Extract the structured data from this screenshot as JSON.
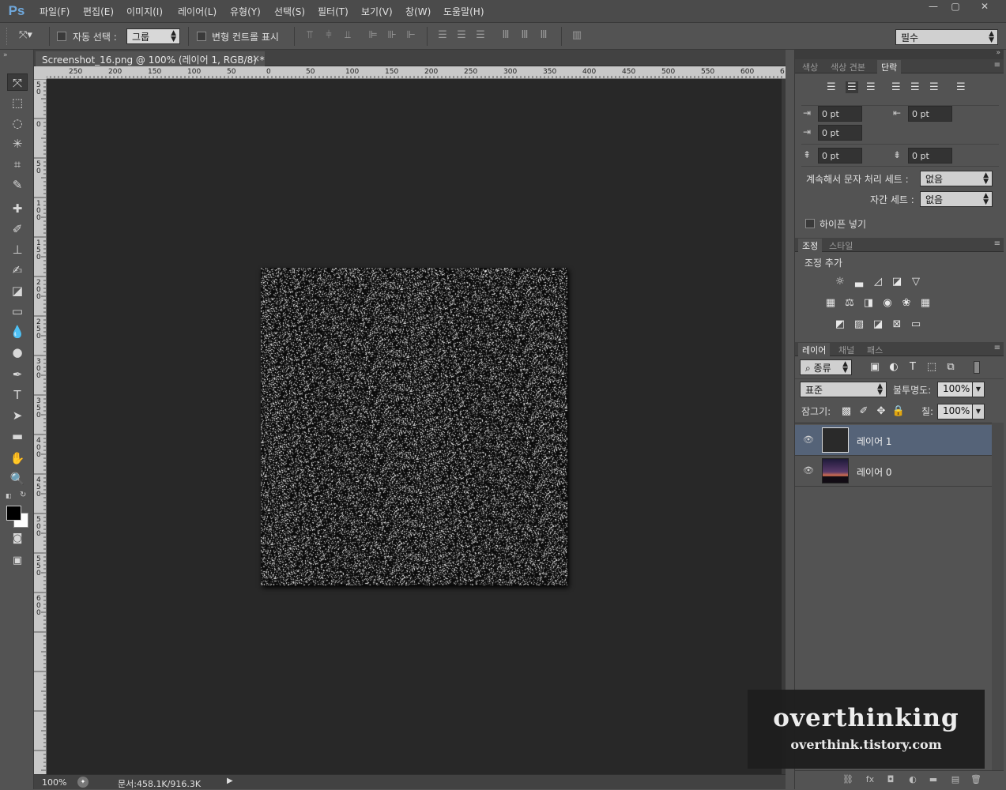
{
  "app": {
    "logo": "Ps"
  },
  "menu": [
    "파일(F)",
    "편집(E)",
    "이미지(I)",
    "레이어(L)",
    "유형(Y)",
    "선택(S)",
    "필터(T)",
    "보기(V)",
    "창(W)",
    "도움말(H)"
  ],
  "window_controls": {
    "minimize": "—",
    "restore": "▢",
    "close": "✕"
  },
  "options_bar": {
    "auto_select_label": "자동 선택 :",
    "auto_select_value": "그룹",
    "transform_label": "변형 컨트롤 표시",
    "workspace": "필수"
  },
  "document": {
    "tab_title": "Screenshot_16.png @ 100% (레이어 1, RGB/8) *",
    "h_ruler_labels": [
      "250",
      "200",
      "150",
      "100",
      "50",
      "0",
      "50",
      "100",
      "150",
      "200",
      "250",
      "300",
      "350",
      "400",
      "450",
      "500",
      "550",
      "600",
      "6"
    ],
    "v_ruler_labels": [
      "50",
      "0",
      "50",
      "100",
      "150",
      "200",
      "250",
      "300",
      "350",
      "400",
      "450",
      "500",
      "550",
      "600"
    ],
    "zoom": "100%",
    "doc_size": "문서:458.1K/916.3K"
  },
  "paragraph_panel": {
    "tabs": [
      "색상",
      "색상 견본",
      "단락"
    ],
    "active_tab": "단락",
    "indent_left": "0 pt",
    "indent_right": "0 pt",
    "indent_first": "0 pt",
    "space_before": "0 pt",
    "space_after": "0 pt",
    "kinsoku_label": "계속해서 문자 처리 세트 :",
    "kinsoku_value": "없음",
    "mojikumi_label": "자간 세트 :",
    "mojikumi_value": "없음",
    "hyphenate_label": "하이픈 넣기"
  },
  "adjust_panel": {
    "tabs": [
      "조정",
      "스타일"
    ],
    "active_tab": "조정",
    "title": "조정 추가"
  },
  "layers_panel": {
    "tabs": [
      "레이어",
      "채널",
      "패스"
    ],
    "active_tab": "레이어",
    "filter_kind": "종류",
    "blend_mode": "표준",
    "opacity_label": "불투명도:",
    "opacity_value": "100%",
    "lock_label": "잠그기:",
    "fill_label": "칠:",
    "fill_value": "100%",
    "layers": [
      {
        "name": "레이어 1",
        "selected": true
      },
      {
        "name": "레이어 0",
        "selected": false
      }
    ]
  },
  "watermark": {
    "title": "overthinking",
    "url": "overthink.tistory.com"
  },
  "colors": {
    "selected_layer": "#556378",
    "canvas_bg": "#282828",
    "panel_bg": "#535353"
  }
}
